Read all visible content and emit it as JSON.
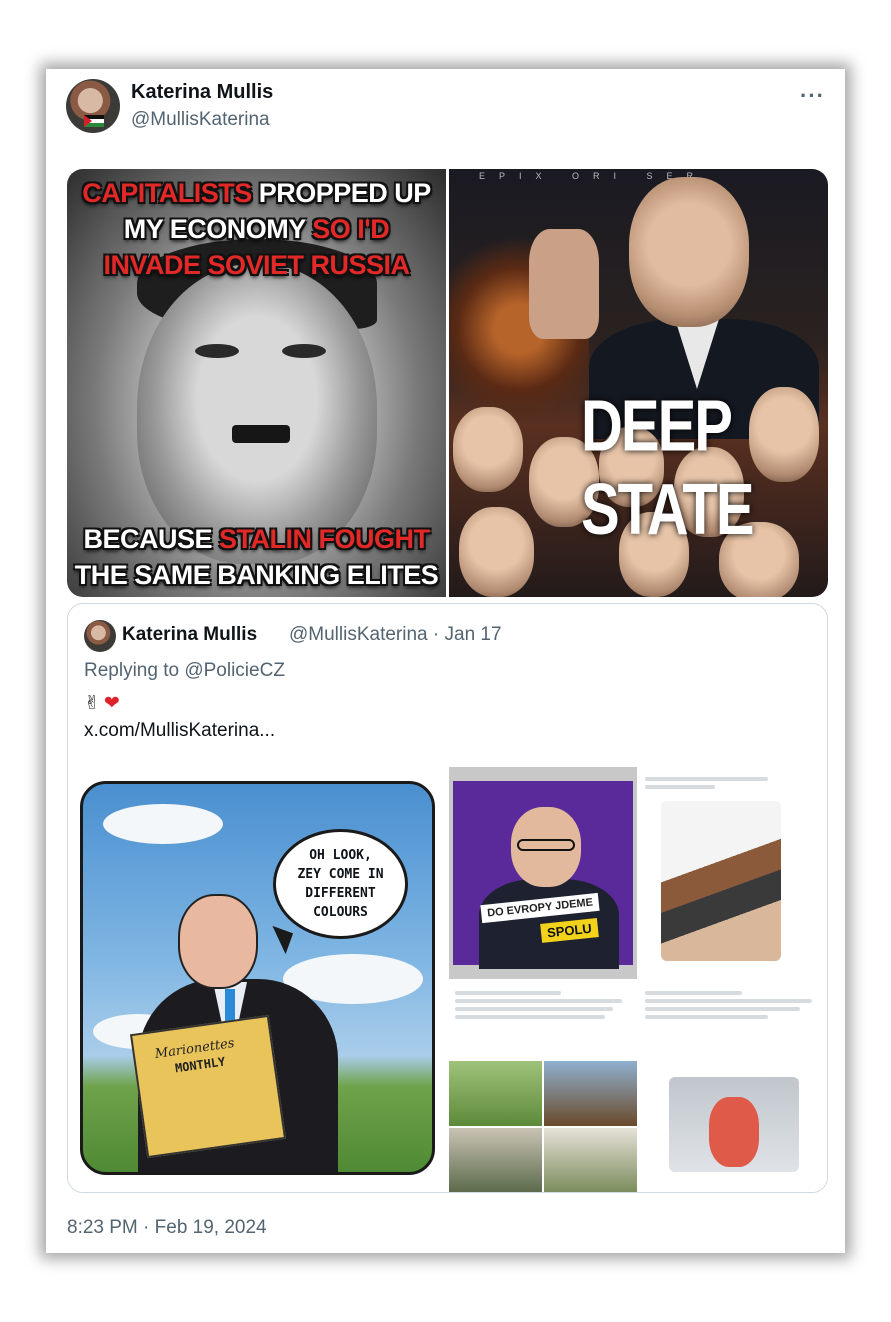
{
  "tweet": {
    "author_name": "Katerina Mullis",
    "author_handle": "@MullisKaterina",
    "more_label": "···",
    "timestamp": "8:23 PM · Feb 19, 2024",
    "image_left": {
      "top_line1_red": "CAPITALISTS",
      "top_line1_white": " PROPPED UP",
      "top_line2_white": "MY  ECONOMY ",
      "top_line2_red": "SO I'D",
      "top_line3_red": "INVADE SOVIET RUSSIA",
      "bottom_line1_white": "BECAUSE ",
      "bottom_line1_red": "STALIN FOUGHT",
      "bottom_line2_white": "THE SAME BANKING ELITES"
    },
    "image_right": {
      "caption": "DEEP STATE",
      "top_text": "EPIX ORI SER"
    }
  },
  "quoted": {
    "author_name": "Katerina Mullis",
    "meta": "@MullisKaterina · Jan 17",
    "replying_to": "Replying to @PolicieCZ",
    "emoji": [
      "✌",
      "❤"
    ],
    "link": "x.com/MullisKaterina...",
    "cartoon": {
      "bubble_lines": [
        "OH LOOK,",
        "ZEY COME IN",
        "DIFFERENT",
        "COLOURS"
      ],
      "book_title": "Marionettes",
      "book_subtitle": "MONTHLY"
    },
    "collage": {
      "banner_top": "DO EVROPY JDEME",
      "banner_bottom": "SPOLU"
    }
  },
  "colors": {
    "text_primary": "#0f1419",
    "text_secondary": "#536471",
    "border": "#cfd9de",
    "meme_red": "#e32828"
  }
}
